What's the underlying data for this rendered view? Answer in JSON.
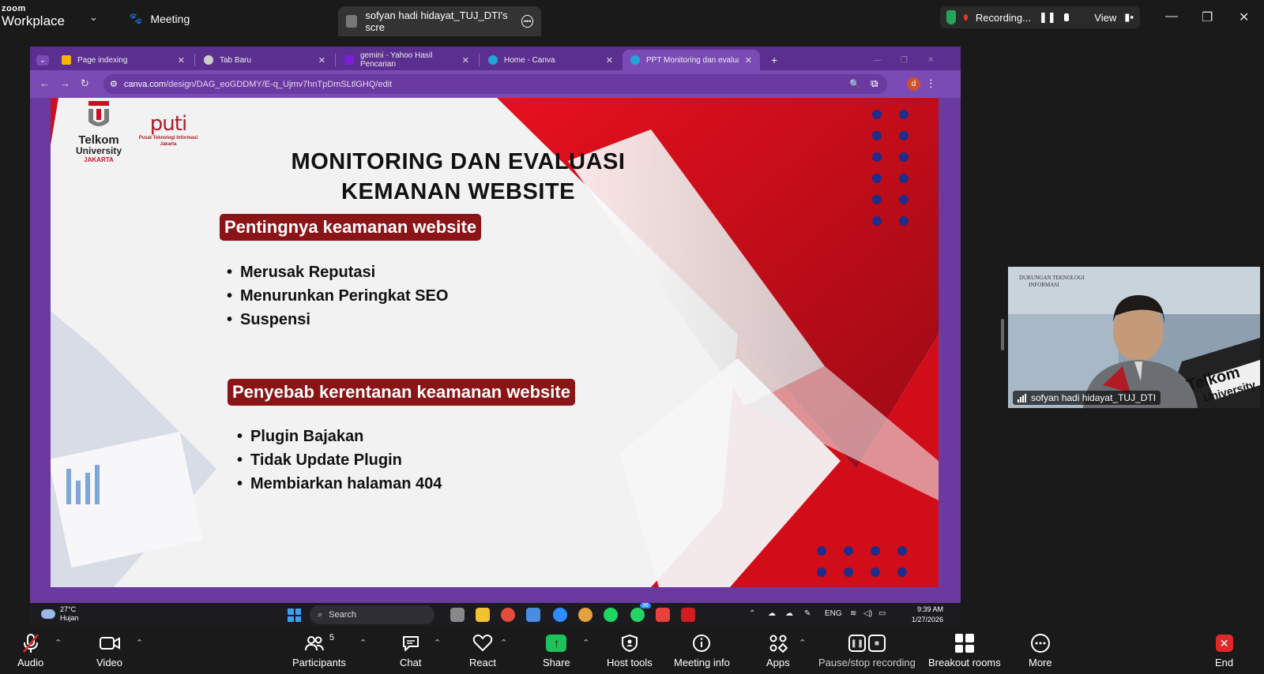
{
  "zoom": {
    "brand_small": "zoom",
    "brand_large": "Workplace",
    "meeting_label": "Meeting",
    "share_tab_title": "sofyan hadi hidayat_TUJ_DTI's scre",
    "recording_label": "Recording...",
    "view_label": "View"
  },
  "browser": {
    "tabs": [
      {
        "label": "Page indexing",
        "color": "#f4b400"
      },
      {
        "label": "Tab Baru",
        "color": "#cccccc"
      },
      {
        "label": "gemini - Yahoo Hasil Pencarian",
        "color": "#7b1fd6"
      },
      {
        "label": "Home - Canva",
        "color": "#20a6d6"
      },
      {
        "label": "PPT Monitoring dan evaluasi SI",
        "color": "#20a6d6"
      }
    ],
    "url_domain": "canva.com",
    "url_path": "/design/DAG_eoGDDMY/E-q_Ujmv7hnTpDmSLtlGHQ/edit",
    "profile_initial": "d"
  },
  "slide": {
    "telkom_line1": "Telkom",
    "telkom_line2": "University",
    "telkom_line3": "JAKARTA",
    "pti_word": "puti",
    "pti_sub1": "Pusat Teknologi Informasi",
    "pti_sub2": "Jakarta",
    "title_line1": "MONITORING DAN EVALUASI",
    "title_line2": "KEMANAN WEBSITE",
    "section1_heading": "Pentingnya keamanan website",
    "section1_items": [
      "Merusak Reputasi",
      "Menurunkan Peringkat SEO",
      "Suspensi"
    ],
    "section2_heading": "Penyebab kerentanan keamanan website",
    "section2_items": [
      "Plugin Bajakan",
      "Tidak Update Plugin",
      "Membiarkan halaman 404"
    ],
    "colors": {
      "red": "#c8101e",
      "dark_red": "#8b1416",
      "dot_blue": "#1f2c8a"
    }
  },
  "taskbar": {
    "temp": "27°C",
    "weather": "Hujan",
    "search_label": "Search",
    "lang": "ENG",
    "time": "9:39 AM",
    "date": "1/27/2026",
    "badge_whatsapp": "36"
  },
  "video": {
    "participant_name": "sofyan hadi hidayat_TUJ_DTI",
    "banner_text1": "DUKUNGAN TEKNOLOGI",
    "banner_text2": "INFORMASI",
    "wall_text1": "Telkom",
    "wall_text2": "University"
  },
  "toolbar": {
    "audio": "Audio",
    "video": "Video",
    "participants": "Participants",
    "participants_count": "5",
    "chat": "Chat",
    "react": "React",
    "share": "Share",
    "host_tools": "Host tools",
    "meeting_info": "Meeting info",
    "apps": "Apps",
    "pause_recording": "Pause/stop recording",
    "breakout_rooms": "Breakout rooms",
    "more": "More",
    "end": "End"
  }
}
